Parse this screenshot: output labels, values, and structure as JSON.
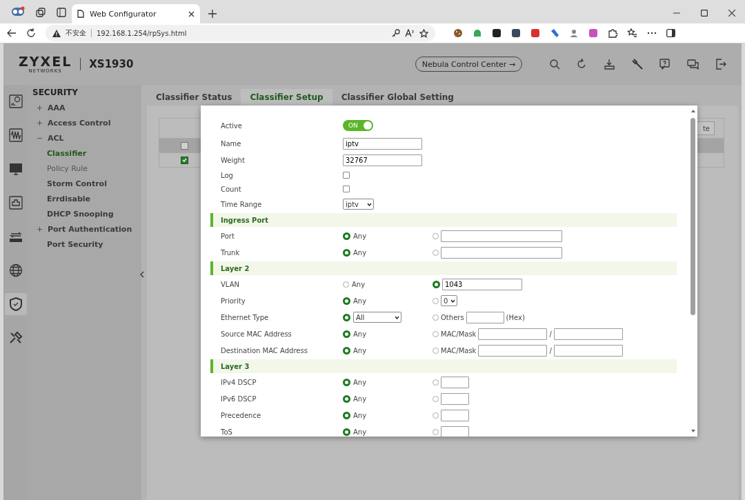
{
  "browser": {
    "tab": {
      "title": "Web Configurator",
      "selected": true
    },
    "address": {
      "security": "不安全",
      "url": "192.168.1.254/rpSys.html"
    }
  },
  "header": {
    "brand": "ZYXEL",
    "brand_sub": "NETWORKS",
    "model": "XS1930",
    "nebula_button": "Nebula Control Center →"
  },
  "sidebar_icons": [
    {
      "selected": false
    },
    {
      "selected": false
    },
    {
      "selected": false
    },
    {
      "selected": false
    },
    {
      "selected": false
    },
    {
      "selected": false
    },
    {
      "selected": true
    },
    {
      "selected": false
    }
  ],
  "nav": {
    "title": "SECURITY",
    "items": [
      {
        "kind": "group",
        "label": "AAA",
        "expanded": false
      },
      {
        "kind": "group",
        "label": "Access Control",
        "expanded": false
      },
      {
        "kind": "group",
        "label": "ACL",
        "expanded": true,
        "children": [
          {
            "label": "Classifier",
            "selected": true
          },
          {
            "label": "Policy Rule",
            "selected": false
          }
        ]
      },
      {
        "kind": "page",
        "label": "Storm Control",
        "selected": false
      },
      {
        "kind": "page",
        "label": "Errdisable",
        "selected": false
      },
      {
        "kind": "page",
        "label": "DHCP Snooping",
        "selected": false
      },
      {
        "kind": "group",
        "label": "Port Authentication",
        "expanded": false
      },
      {
        "kind": "page",
        "label": "Port Security",
        "selected": false
      }
    ]
  },
  "tabs": [
    {
      "label": "Classifier Status",
      "selected": false
    },
    {
      "label": "Classifier Setup",
      "selected": true
    },
    {
      "label": "Classifier Global Setting",
      "selected": false
    }
  ],
  "table": {
    "rows": [
      {
        "checked": false
      },
      {
        "checked": true
      }
    ],
    "button": "te"
  },
  "dialog": {
    "rows": [
      {
        "kind": "toggle",
        "label": "Active",
        "on": true,
        "text": "ON"
      },
      {
        "kind": "input",
        "label": "Name",
        "value": "iptv"
      },
      {
        "kind": "input",
        "label": "Weight",
        "value": "32767"
      },
      {
        "kind": "checkbox",
        "label": "Log",
        "checked": false
      },
      {
        "kind": "checkbox",
        "label": "Count",
        "checked": false
      },
      {
        "kind": "select",
        "label": "Time Range",
        "value": "iptv"
      },
      {
        "kind": "section",
        "label": "Ingress Port"
      },
      {
        "kind": "radio",
        "label": "Port",
        "options": [
          {
            "selected": true,
            "parts": [
              {
                "kind": "text",
                "text": "Any"
              }
            ]
          },
          {
            "selected": false,
            "parts": [
              {
                "kind": "listfield"
              }
            ]
          }
        ]
      },
      {
        "kind": "radio",
        "label": "Trunk",
        "options": [
          {
            "selected": true,
            "parts": [
              {
                "kind": "text",
                "text": "Any"
              }
            ]
          },
          {
            "selected": false,
            "parts": [
              {
                "kind": "listfield"
              }
            ]
          }
        ]
      },
      {
        "kind": "section",
        "label": "Layer 2"
      },
      {
        "kind": "radio",
        "label": "VLAN",
        "options": [
          {
            "selected": false,
            "parts": [
              {
                "kind": "text",
                "text": "Any"
              }
            ]
          },
          {
            "selected": true,
            "parts": [
              {
                "kind": "idfield",
                "value": "1043"
              }
            ]
          }
        ]
      },
      {
        "kind": "radio",
        "label": "Priority",
        "options": [
          {
            "selected": true,
            "parts": [
              {
                "kind": "text",
                "text": "Any"
              }
            ]
          },
          {
            "selected": false,
            "parts": [
              {
                "kind": "select",
                "value": "0"
              }
            ]
          }
        ]
      },
      {
        "kind": "radio",
        "label": "Ethernet Type",
        "options": [
          {
            "selected": true,
            "parts": [
              {
                "kind": "combo",
                "value": "All"
              }
            ]
          },
          {
            "selected": false,
            "parts": [
              {
                "kind": "text",
                "text": "Others"
              },
              {
                "kind": "hexfield"
              },
              {
                "kind": "text",
                "text": "(Hex)"
              }
            ]
          }
        ]
      },
      {
        "kind": "radio",
        "label": "Source MAC Address",
        "options": [
          {
            "selected": true,
            "parts": [
              {
                "kind": "text",
                "text": "Any"
              }
            ]
          },
          {
            "selected": false,
            "parts": [
              {
                "kind": "text",
                "text": "MAC/Mask"
              },
              {
                "kind": "macfield"
              },
              {
                "kind": "text",
                "text": "/"
              },
              {
                "kind": "macfield"
              }
            ]
          }
        ]
      },
      {
        "kind": "radio",
        "label": "Destination MAC Address",
        "options": [
          {
            "selected": true,
            "parts": [
              {
                "kind": "text",
                "text": "Any"
              }
            ]
          },
          {
            "selected": false,
            "parts": [
              {
                "kind": "text",
                "text": "MAC/Mask"
              },
              {
                "kind": "macfield"
              },
              {
                "kind": "text",
                "text": "/"
              },
              {
                "kind": "macfield"
              }
            ]
          }
        ]
      },
      {
        "kind": "section",
        "label": "Layer 3"
      },
      {
        "kind": "radio",
        "label": "IPv4 DSCP",
        "options": [
          {
            "selected": true,
            "parts": [
              {
                "kind": "text",
                "text": "Any"
              }
            ]
          },
          {
            "selected": false,
            "parts": [
              {
                "kind": "codefield"
              }
            ]
          }
        ]
      },
      {
        "kind": "radio",
        "label": "IPv6 DSCP",
        "options": [
          {
            "selected": true,
            "parts": [
              {
                "kind": "text",
                "text": "Any"
              }
            ]
          },
          {
            "selected": false,
            "parts": [
              {
                "kind": "codefield"
              }
            ]
          }
        ]
      },
      {
        "kind": "radio",
        "label": "Precedence",
        "options": [
          {
            "selected": true,
            "parts": [
              {
                "kind": "text",
                "text": "Any"
              }
            ]
          },
          {
            "selected": false,
            "parts": [
              {
                "kind": "codefield"
              }
            ]
          }
        ]
      },
      {
        "kind": "radio",
        "label": "ToS",
        "options": [
          {
            "selected": true,
            "parts": [
              {
                "kind": "text",
                "text": "Any"
              }
            ]
          },
          {
            "selected": false,
            "parts": [
              {
                "kind": "codefield"
              }
            ]
          }
        ]
      }
    ]
  }
}
